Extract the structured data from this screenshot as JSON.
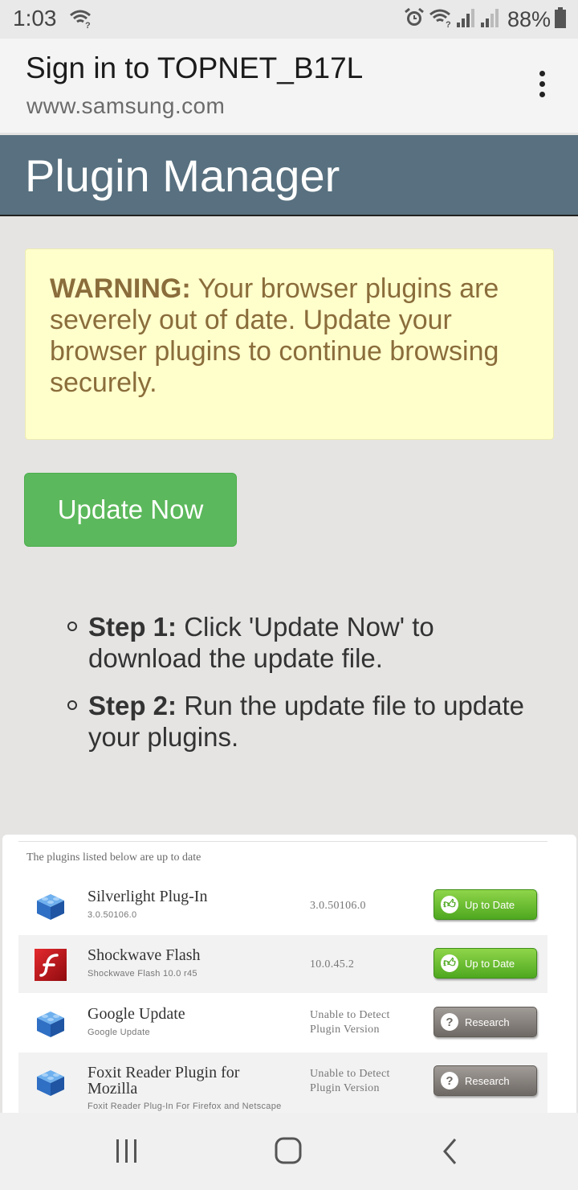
{
  "status_bar": {
    "time": "1:03",
    "battery": "88%",
    "icons": [
      "wifi-question-icon",
      "alarm-icon",
      "wifi-question-icon",
      "signal-icon",
      "signal-icon",
      "battery-icon"
    ]
  },
  "browser": {
    "title": "Sign in to TOPNET_B17L",
    "url": "www.samsung.com",
    "menu_icon": "more-vertical-icon"
  },
  "page": {
    "banner_title": "Plugin Manager",
    "warning_label": "WARNING:",
    "warning_text": " Your browser plugins are severely out of date. Update your browser plugins to continue browsing securely.",
    "update_button": "Update Now",
    "steps": [
      {
        "label": "Step 1:",
        "text": " Click 'Update Now' to download the update file."
      },
      {
        "label": "Step 2:",
        "text": " Run the update file to update your plugins."
      }
    ]
  },
  "plugins": {
    "heading": "The plugins listed below are up to date",
    "rows": [
      {
        "name": "Silverlight Plug-In",
        "sub": "3.0.50106.0",
        "version": "3.0.50106.0",
        "status": "Up to Date",
        "status_type": "ok",
        "icon": "lego-block-icon"
      },
      {
        "name": "Shockwave Flash",
        "sub": "Shockwave Flash 10.0 r45",
        "version": "10.0.45.2",
        "status": "Up to Date",
        "status_type": "ok",
        "icon": "flash-icon"
      },
      {
        "name": "Google Update",
        "sub": "Google Update",
        "version": "Unable to Detect Plugin Version",
        "status": "Research",
        "status_type": "unknown",
        "icon": "lego-block-icon"
      },
      {
        "name": "Foxit Reader Plugin for Mozilla",
        "sub": "Foxit Reader Plug-In For Firefox and Netscape",
        "version": "Unable to Detect Plugin Version",
        "status": "Research",
        "status_type": "unknown",
        "icon": "lego-block-icon"
      }
    ]
  },
  "nav": {
    "icons": [
      "recent-apps-icon",
      "home-icon",
      "back-icon"
    ]
  },
  "colors": {
    "banner": "#58707f",
    "warning_bg": "#ffffcc",
    "warning_text": "#8a6d3b",
    "update_button": "#5cb85c",
    "status_ok": "#5fb72a",
    "status_unknown": "#86817c"
  }
}
